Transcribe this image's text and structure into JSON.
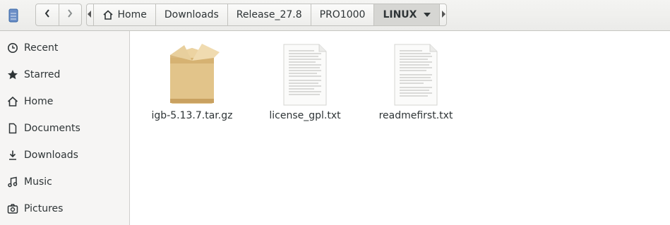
{
  "breadcrumbs": [
    {
      "label": "Home",
      "icon": "home-icon"
    },
    {
      "label": "Downloads"
    },
    {
      "label": "Release_27.8"
    },
    {
      "label": "PRO1000"
    },
    {
      "label": "LINUX",
      "active": true
    }
  ],
  "sidebar": {
    "items": [
      {
        "label": "Recent",
        "icon": "clock-icon"
      },
      {
        "label": "Starred",
        "icon": "star-icon"
      },
      {
        "label": "Home",
        "icon": "home-icon"
      },
      {
        "label": "Documents",
        "icon": "document-icon"
      },
      {
        "label": "Downloads",
        "icon": "download-icon"
      },
      {
        "label": "Music",
        "icon": "music-icon"
      },
      {
        "label": "Pictures",
        "icon": "camera-icon"
      }
    ]
  },
  "files": [
    {
      "name": "igb-5.13.7.tar.gz",
      "icon": "package-icon"
    },
    {
      "name": "license_gpl.txt",
      "icon": "text-file-icon"
    },
    {
      "name": "readmefirst.txt",
      "icon": "text-file-icon"
    }
  ],
  "colors": {
    "accent": "#3465a4",
    "header": "#ebebe9",
    "sidebar": "#f6f5f4"
  }
}
